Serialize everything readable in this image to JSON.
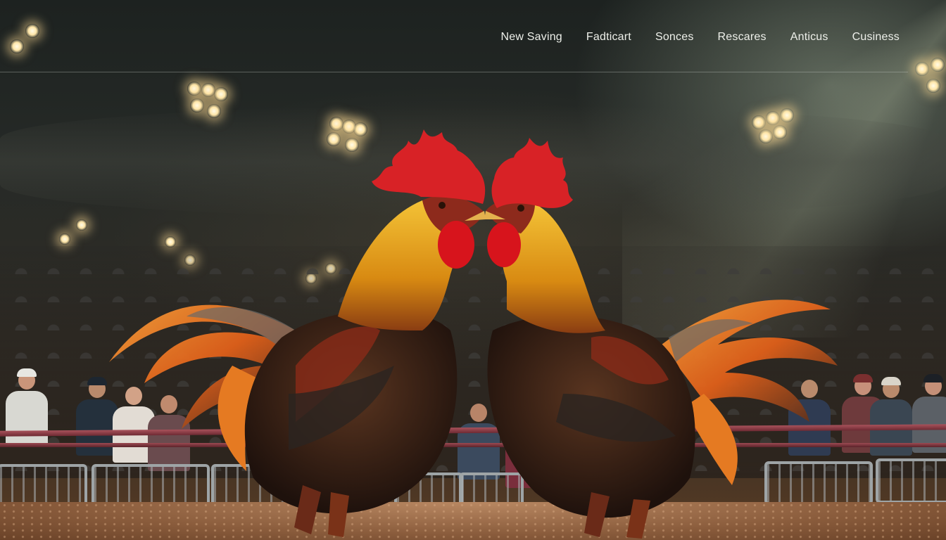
{
  "nav": {
    "items": [
      {
        "label": "New Saving"
      },
      {
        "label": "Fadticart"
      },
      {
        "label": "Sonces"
      },
      {
        "label": "Rescares"
      },
      {
        "label": "Anticus"
      },
      {
        "label": "Cusiness"
      }
    ]
  },
  "colors": {
    "nav_text": "#eef0ea",
    "comb_red": "#e2262a",
    "hackle_gold": "#e6a21c",
    "tail_orange": "#f0822a",
    "body_dark": "#2b1a12",
    "ground": "#a87552"
  },
  "scene": {
    "icons": [
      "stadium-light-icon",
      "rooster-left-illustration",
      "rooster-right-illustration"
    ]
  }
}
